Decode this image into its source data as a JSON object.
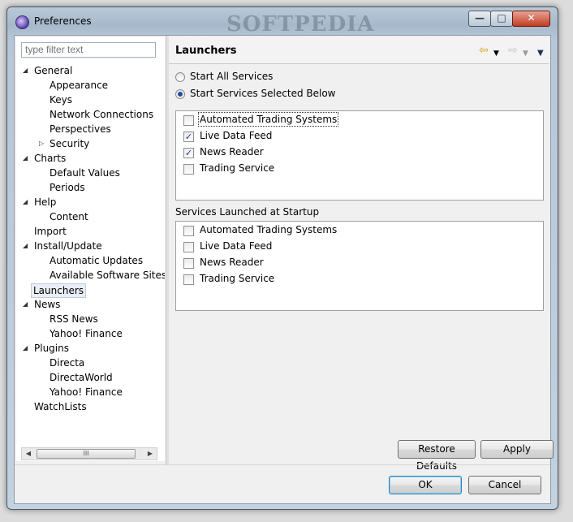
{
  "window": {
    "title": "Preferences",
    "watermark": "SOFTPEDIA",
    "minimize_glyph": "—",
    "maximize_glyph": "□",
    "close_glyph": "✕"
  },
  "filter": {
    "placeholder": "type filter text"
  },
  "tree": {
    "expand_glyph": "◢",
    "collapse_glyph": "▷",
    "nodes": [
      {
        "label": "General"
      },
      {
        "label": "Appearance"
      },
      {
        "label": "Keys"
      },
      {
        "label": "Network Connections"
      },
      {
        "label": "Perspectives"
      },
      {
        "label": "Security"
      },
      {
        "label": "Charts"
      },
      {
        "label": "Default Values"
      },
      {
        "label": "Periods"
      },
      {
        "label": "Help"
      },
      {
        "label": "Content"
      },
      {
        "label": "Import"
      },
      {
        "label": "Install/Update"
      },
      {
        "label": "Automatic Updates"
      },
      {
        "label": "Available Software Sites"
      },
      {
        "label": "Launchers"
      },
      {
        "label": "News"
      },
      {
        "label": "RSS News"
      },
      {
        "label": "Yahoo! Finance"
      },
      {
        "label": "Plugins"
      },
      {
        "label": "Directa"
      },
      {
        "label": "DirectaWorld"
      },
      {
        "label": "Yahoo! Finance"
      },
      {
        "label": "WatchLists"
      }
    ],
    "scroll_grip": "III",
    "scroll_left": "◀",
    "scroll_right": "▶"
  },
  "page": {
    "title": "Launchers",
    "back_arrow": "⇦",
    "forward_arrow": "⇨",
    "dropdown_glyph": "▼",
    "radio_all": "Start All Services",
    "radio_selected": "Start Services Selected Below",
    "selected_services": [
      {
        "label": "Automated Trading Systems",
        "checked": false
      },
      {
        "label": "Live Data Feed",
        "checked": true
      },
      {
        "label": "News Reader",
        "checked": true
      },
      {
        "label": "Trading Service",
        "checked": false
      }
    ],
    "startup_section_label": "Services Launched at Startup",
    "startup_services": [
      {
        "label": "Automated Trading Systems",
        "checked": false
      },
      {
        "label": "Live Data Feed",
        "checked": false
      },
      {
        "label": "News Reader",
        "checked": false
      },
      {
        "label": "Trading Service",
        "checked": false
      }
    ],
    "check_glyph": "✓"
  },
  "buttons": {
    "restore_defaults": "Restore Defaults",
    "apply": "Apply",
    "ok": "OK",
    "cancel": "Cancel"
  }
}
